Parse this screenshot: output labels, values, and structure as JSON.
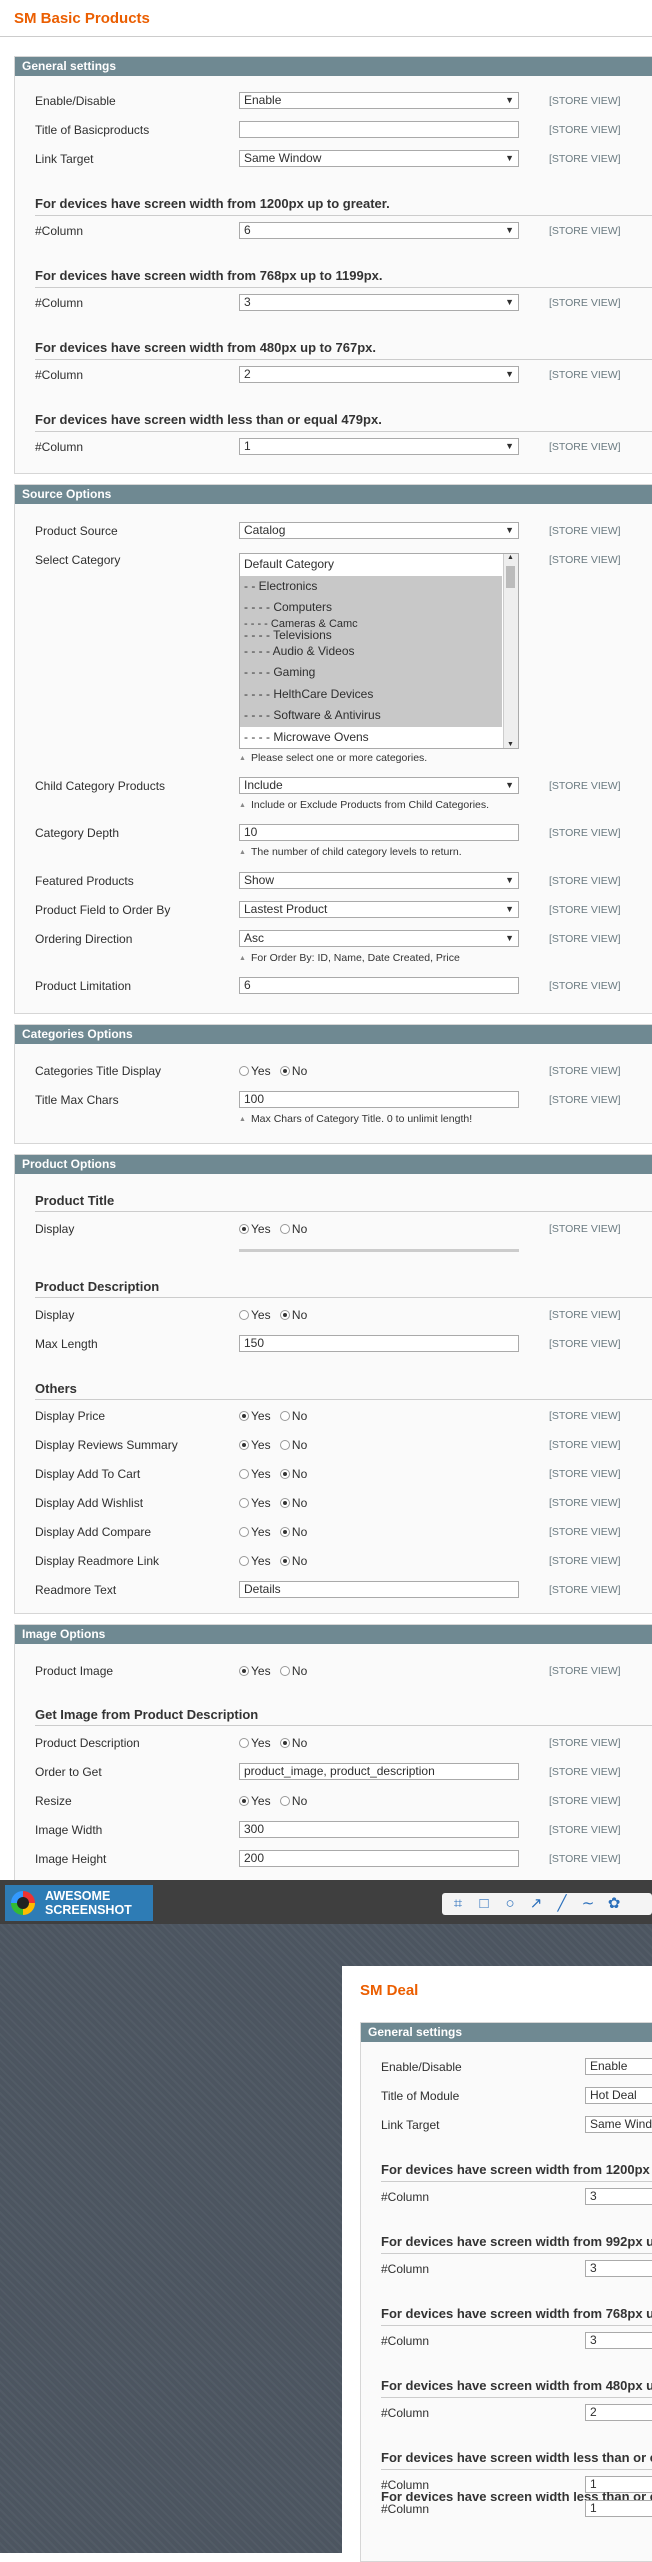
{
  "page_title": "SM Basic Products",
  "store_view": "[STORE VIEW]",
  "general": {
    "header": "General settings",
    "enable_label": "Enable/Disable",
    "enable_value": "Enable",
    "title_label": "Title of Basicproducts",
    "title_value": "",
    "link_label": "Link Target",
    "link_value": "Same Window",
    "h1200": "For devices have screen width from 1200px up to greater.",
    "col_label": "#Column",
    "col1200": "6",
    "h768": "For devices have screen width from 768px up to 1199px.",
    "col768": "3",
    "h480": "For devices have screen width from 480px up to 767px.",
    "col480": "2",
    "h479": "For devices have screen width less than or equal 479px.",
    "col479": "1"
  },
  "source": {
    "header": "Source Options",
    "product_source_label": "Product Source",
    "product_source_value": "Catalog",
    "select_category_label": "Select Category",
    "categories": [
      "Default Category",
      "- - Electronics",
      "- - - - Computers",
      "- - - - Cameras & Camc",
      "- - - - Televisions",
      "- - - - Audio & Videos",
      "- - - - Gaming",
      "- - - - HelthCare Devices",
      "- - - - Software & Antivirus",
      "- - - - Microwave Ovens"
    ],
    "category_note": "Please select one or more categories.",
    "child_label": "Child Category Products",
    "child_value": "Include",
    "child_note": "Include or Exclude Products from Child Categories.",
    "depth_label": "Category Depth",
    "depth_value": "10",
    "depth_note": "The number of child category levels to return.",
    "featured_label": "Featured Products",
    "featured_value": "Show",
    "order_field_label": "Product Field to Order By",
    "order_field_value": "Lastest Product",
    "order_dir_label": "Ordering Direction",
    "order_dir_value": "Asc",
    "order_note": "For Order By: ID, Name, Date Created, Price",
    "limit_label": "Product Limitation",
    "limit_value": "6"
  },
  "categories_opts": {
    "header": "Categories Options",
    "display_label": "Categories Title Display",
    "max_label": "Title Max Chars",
    "max_value": "100",
    "max_note": "Max Chars of Category Title. 0 to unlimit length!"
  },
  "yes": "Yes",
  "no": "No",
  "product": {
    "header": "Product Options",
    "title_head": "Product Title",
    "display_label": "Display",
    "desc_head": "Product Description",
    "maxlen_label": "Max Length",
    "maxlen_value": "150",
    "others_head": "Others",
    "price_label": "Display Price",
    "reviews_label": "Display Reviews Summary",
    "cart_label": "Display Add To Cart",
    "wishlist_label": "Display Add Wishlist",
    "compare_label": "Display Add Compare",
    "readmore_label": "Display Readmore Link",
    "readmore_text_label": "Readmore Text",
    "readmore_text_value": "Details"
  },
  "image": {
    "header": "Image Options",
    "product_image_label": "Product Image",
    "from_desc_head": "Get Image from Product Description",
    "pd_label": "Product Description",
    "order_label": "Order to Get",
    "order_value": "product_image, product_description",
    "resize_label": "Resize",
    "width_label": "Image Width",
    "width_value": "300",
    "height_label": "Image Height",
    "height_value": "200"
  },
  "toolbar": {
    "logo_line1": "AWESOME",
    "logo_line2": "SCREENSHOT"
  },
  "deal": {
    "title": "SM Deal",
    "header": "General settings",
    "enable_label": "Enable/Disable",
    "enable_value": "Enable",
    "title_label": "Title of Module",
    "title_value": "Hot Deal",
    "link_label": "Link Target",
    "link_value": "Same Wind",
    "h1200": "For devices have screen width from 1200px",
    "c1": "3",
    "h992": "For devices have screen width from 992px u",
    "c2": "3",
    "h768": "For devices have screen width from 768px u",
    "c3": "3",
    "h480": "For devices have screen width from 480px u",
    "c4": "2",
    "hless": "For devices have screen width less than or e",
    "c5": "1",
    "hless2": "For devices have screen width less than or e",
    "c6": "1",
    "col_label": "#Column"
  }
}
